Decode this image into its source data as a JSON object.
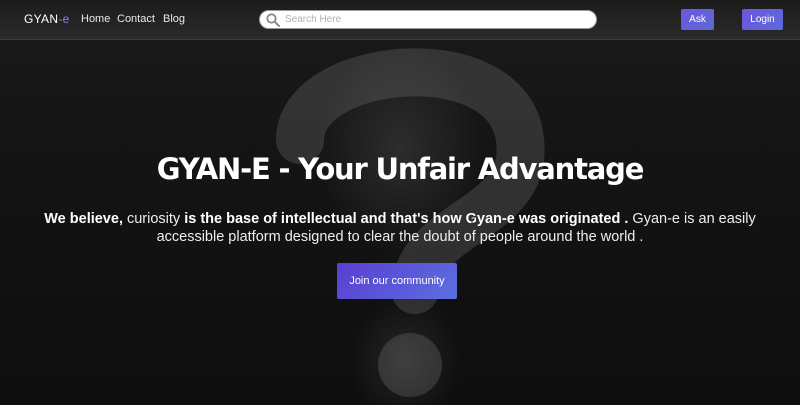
{
  "brand": {
    "name": "GYAN",
    "suffix": "-e"
  },
  "nav": {
    "home": "Home",
    "contact": "Contact",
    "blog": "Blog"
  },
  "search": {
    "placeholder": "Search Here",
    "value": ""
  },
  "actions": {
    "ask": "Ask",
    "login": "Login"
  },
  "hero": {
    "title": "GYAN-E - Your Unfair Advantage",
    "p1_bold": "We believe,",
    "p2": " curiosity ",
    "p3_bold": "is the base of intellectual and that's how Gyan-e was originated .",
    "p4": " Gyan-e is an easily accessible platform designed to clear the doubt of people around the world .",
    "cta": "Join our community"
  },
  "colors": {
    "accent": "#6e55e0",
    "accent2": "#5b6fe0",
    "brand_suffix": "#8c7bff"
  },
  "icons": {
    "search": "search-icon",
    "background": "question-mark-icon"
  }
}
